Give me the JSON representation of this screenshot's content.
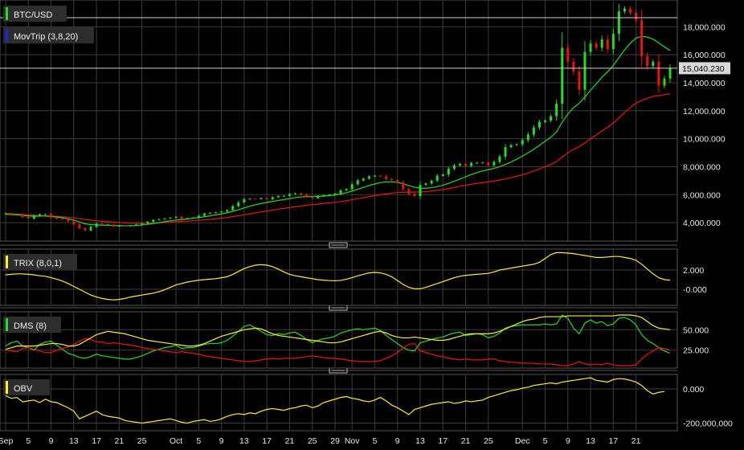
{
  "colors": {
    "background": "#000000",
    "grid": "#3c3c3c",
    "axis_text": "#e6e6e6",
    "candle_up": "#22dd22",
    "candle_down": "#ee1111",
    "ma_fast": "#22dd22",
    "ma_slow": "#ee1111",
    "indicator_yellow": "#ffee22",
    "label_bg": "#2d2d2d",
    "price_tag_bg": "#d8d8d8"
  },
  "chart_data": [
    {
      "type": "candlestick",
      "title": "BTC/USD",
      "legend_color": "#22dd22",
      "overlay": {
        "label": "MovTrip (3,8,20)",
        "legend_color": "#1a2ad8"
      },
      "last_price_label": "15,040.230",
      "last_price": 15040.23,
      "ylim": [
        2800,
        19800
      ],
      "yticks": [
        4000,
        6000,
        8000,
        10000,
        12000,
        14000,
        16000,
        18000
      ],
      "ytick_labels": [
        "4,000.000",
        "6,000.000",
        "8,000.000",
        "10,000.000",
        "12,000.000",
        "14,000.000",
        "16,000.000",
        "18,000.000"
      ],
      "x_labels": [
        "Sep",
        "5",
        "9",
        "13",
        "17",
        "21",
        "25",
        "Oct",
        "5",
        "9",
        "13",
        "17",
        "21",
        "25",
        "29",
        "Nov",
        "5",
        "9",
        "13",
        "17",
        "21",
        "25",
        "Dec",
        "5",
        "9",
        "13",
        "17",
        "21"
      ],
      "x_label_index": [
        0,
        4,
        8,
        12,
        16,
        20,
        24,
        30,
        34,
        38,
        42,
        46,
        50,
        54,
        58,
        61,
        65,
        69,
        73,
        77,
        81,
        85,
        91,
        95,
        99,
        103,
        107,
        111
      ],
      "close": [
        4680,
        4580,
        4600,
        4400,
        4300,
        4500,
        4600,
        4610,
        4380,
        4280,
        4230,
        4100,
        3880,
        3600,
        3450,
        3700,
        3930,
        3850,
        3870,
        3740,
        3780,
        3750,
        3800,
        3870,
        3950,
        4070,
        4200,
        4250,
        4300,
        4350,
        4420,
        4250,
        4320,
        4360,
        4500,
        4650,
        4710,
        4750,
        4800,
        4900,
        5180,
        5450,
        5680,
        5710,
        5690,
        5760,
        5680,
        5820,
        5900,
        5920,
        6050,
        6100,
        6010,
        5850,
        5750,
        5890,
        5960,
        6000,
        6080,
        6310,
        6400,
        6740,
        7020,
        7150,
        7310,
        7350,
        7320,
        7120,
        7050,
        6880,
        6400,
        6050,
        5900,
        6700,
        6800,
        7000,
        7350,
        7450,
        7850,
        8100,
        8200,
        8050,
        8260,
        8290,
        8300,
        8100,
        8350,
        8730,
        9400,
        9550,
        9600,
        9900,
        10300,
        10800,
        11200,
        11300,
        11600,
        12500,
        16500,
        15500,
        14800,
        13500,
        16200,
        16800,
        16500,
        17100,
        16400,
        17500,
        19100,
        19300,
        19000,
        18500,
        15900,
        15200,
        15500,
        13800,
        14300,
        15040
      ],
      "ma_fast": [
        4590,
        4580,
        4560,
        4520,
        4480,
        4460,
        4470,
        4470,
        4440,
        4400,
        4350,
        4280,
        4180,
        4050,
        3920,
        3860,
        3850,
        3820,
        3820,
        3800,
        3790,
        3780,
        3780,
        3800,
        3830,
        3880,
        3940,
        4000,
        4070,
        4130,
        4190,
        4230,
        4270,
        4310,
        4360,
        4420,
        4490,
        4560,
        4630,
        4710,
        4810,
        4930,
        5060,
        5180,
        5280,
        5370,
        5450,
        5520,
        5590,
        5650,
        5720,
        5790,
        5840,
        5860,
        5870,
        5880,
        5900,
        5930,
        5980,
        6050,
        6140,
        6250,
        6380,
        6520,
        6650,
        6770,
        6860,
        6920,
        6920,
        6880,
        6780,
        6650,
        6530,
        6470,
        6460,
        6500,
        6580,
        6680,
        6810,
        6960,
        7120,
        7280,
        7440,
        7580,
        7700,
        7790,
        7880,
        8000,
        8160,
        8340,
        8540,
        8760,
        8990,
        9250,
        9530,
        9820,
        10110,
        10480,
        11180,
        11760,
        12220,
        12540,
        12980,
        13470,
        13920,
        14390,
        14780,
        15240,
        15800,
        16360,
        16830,
        17190,
        17320,
        17260,
        17120,
        16850,
        16560,
        16300
      ],
      "ma_slow": [
        4650,
        4630,
        4610,
        4590,
        4560,
        4530,
        4510,
        4490,
        4470,
        4450,
        4420,
        4390,
        4340,
        4290,
        4230,
        4180,
        4140,
        4100,
        4070,
        4040,
        4010,
        3990,
        3970,
        3960,
        3950,
        3960,
        3970,
        3990,
        4010,
        4040,
        4070,
        4090,
        4110,
        4140,
        4170,
        4200,
        4240,
        4280,
        4320,
        4370,
        4430,
        4490,
        4560,
        4630,
        4700,
        4770,
        4840,
        4900,
        4960,
        5020,
        5080,
        5140,
        5190,
        5240,
        5280,
        5320,
        5370,
        5410,
        5460,
        5510,
        5570,
        5640,
        5710,
        5780,
        5860,
        5930,
        6000,
        6060,
        6110,
        6150,
        6170,
        6180,
        6180,
        6200,
        6220,
        6260,
        6310,
        6370,
        6440,
        6520,
        6600,
        6670,
        6740,
        6810,
        6870,
        6920,
        6980,
        7050,
        7130,
        7220,
        7320,
        7430,
        7550,
        7690,
        7840,
        8000,
        8160,
        8360,
        8700,
        8990,
        9240,
        9430,
        9700,
        10000,
        10270,
        10560,
        10820,
        11130,
        11500,
        11880,
        12230,
        12540,
        12740,
        12900,
        13030,
        13080,
        13140,
        13230
      ]
    },
    {
      "type": "line",
      "title": "TRIX (8,0,1)",
      "legend_color": "#ffee22",
      "ylim": [
        -1.5,
        4.0
      ],
      "yticks": [
        2,
        0
      ],
      "ytick_labels": [
        "2.000",
        "-0.000"
      ],
      "series": [
        {
          "values": [
            1.5,
            1.55,
            1.6,
            1.6,
            1.55,
            1.5,
            1.4,
            1.35,
            1.2,
            1.05,
            0.85,
            0.6,
            0.3,
            0.0,
            -0.3,
            -0.6,
            -0.8,
            -0.95,
            -1.05,
            -1.1,
            -1.05,
            -0.95,
            -0.8,
            -0.7,
            -0.6,
            -0.5,
            -0.4,
            -0.25,
            -0.05,
            0.2,
            0.45,
            0.6,
            0.75,
            0.85,
            0.95,
            1.0,
            1.05,
            1.1,
            1.2,
            1.3,
            1.55,
            1.85,
            2.15,
            2.35,
            2.5,
            2.55,
            2.5,
            2.35,
            2.1,
            1.8,
            1.55,
            1.4,
            1.3,
            1.2,
            1.1,
            1.0,
            0.95,
            0.9,
            0.88,
            0.92,
            1.05,
            1.2,
            1.4,
            1.55,
            1.7,
            1.75,
            1.7,
            1.55,
            1.3,
            0.9,
            0.5,
            0.2,
            0.05,
            0.05,
            0.2,
            0.4,
            0.6,
            0.8,
            1.0,
            1.2,
            1.35,
            1.45,
            1.5,
            1.55,
            1.6,
            1.65,
            1.8,
            2.0,
            2.1,
            2.2,
            2.3,
            2.4,
            2.5,
            2.6,
            2.8,
            3.2,
            3.6,
            3.8,
            3.8,
            3.75,
            3.7,
            3.6,
            3.5,
            3.4,
            3.3,
            3.3,
            3.35,
            3.4,
            3.4,
            3.3,
            3.2,
            3.0,
            2.6,
            2.1,
            1.6,
            1.2,
            1.0,
            0.95
          ]
        }
      ]
    },
    {
      "type": "line",
      "title": "DMS (8)",
      "legend_color": "#22dd22",
      "ylim": [
        5,
        70
      ],
      "yticks": [
        50,
        25
      ],
      "ytick_labels": [
        "50.000",
        "25.000"
      ],
      "series": [
        {
          "color": "#22dd22",
          "values": [
            30,
            34,
            36,
            30,
            28,
            25,
            32,
            35,
            36,
            31,
            26,
            21,
            19,
            16,
            15,
            17,
            20,
            18,
            17,
            16,
            15,
            14,
            14,
            16,
            18,
            21,
            24,
            26,
            28,
            29,
            31,
            27,
            28,
            28,
            30,
            32,
            33,
            33,
            34,
            37,
            42,
            48,
            54,
            56,
            52,
            48,
            44,
            43,
            45,
            44,
            46,
            47,
            43,
            38,
            34,
            37,
            39,
            40,
            42,
            46,
            48,
            50,
            51,
            50,
            51,
            52,
            49,
            43,
            38,
            33,
            28,
            25,
            24,
            34,
            36,
            38,
            40,
            41,
            44,
            46,
            47,
            43,
            44,
            45,
            44,
            40,
            42,
            46,
            52,
            54,
            55,
            56,
            56,
            56,
            56,
            57,
            56,
            57,
            68,
            64,
            52,
            45,
            58,
            62,
            58,
            60,
            55,
            57,
            64,
            65,
            62,
            56,
            44,
            37,
            33,
            28,
            24,
            21
          ]
        },
        {
          "color": "#ee1111",
          "values": [
            25,
            24,
            23,
            27,
            28,
            26,
            24,
            22,
            22,
            25,
            27,
            29,
            32,
            36,
            39,
            38,
            35,
            35,
            33,
            34,
            33,
            32,
            31,
            30,
            28,
            27,
            26,
            25,
            24,
            23,
            22,
            23,
            22,
            21,
            20,
            18,
            17,
            16,
            15,
            14,
            13,
            12,
            11,
            11,
            12,
            13,
            14,
            15,
            14,
            15,
            15,
            15,
            16,
            17,
            18,
            17,
            16,
            15,
            15,
            14,
            13,
            12,
            11,
            11,
            11,
            11,
            12,
            15,
            18,
            22,
            28,
            32,
            33,
            24,
            22,
            20,
            18,
            17,
            15,
            14,
            13,
            14,
            13,
            13,
            13,
            14,
            14,
            12,
            11,
            10,
            10,
            9,
            9,
            9,
            8,
            8,
            8,
            7,
            6,
            6,
            8,
            11,
            8,
            7,
            8,
            7,
            9,
            7,
            6,
            6,
            6,
            7,
            14,
            20,
            24,
            28,
            27,
            25
          ]
        },
        {
          "color": "#ffee22",
          "values": [
            26,
            28,
            30,
            30,
            30,
            30,
            31,
            32,
            33,
            33,
            32,
            30,
            30,
            32,
            36,
            40,
            44,
            46,
            48,
            47,
            46,
            45,
            43,
            41,
            39,
            37,
            36,
            35,
            34,
            33,
            32,
            31,
            30,
            30,
            31,
            33,
            36,
            39,
            42,
            44,
            46,
            48,
            50,
            51,
            52,
            51,
            48,
            45,
            43,
            42,
            41,
            40,
            39,
            38,
            37,
            36,
            35,
            34,
            34,
            35,
            37,
            39,
            41,
            43,
            45,
            47,
            48,
            46,
            43,
            41,
            40,
            40,
            41,
            40,
            39,
            38,
            37,
            37,
            38,
            40,
            42,
            44,
            45,
            45,
            45,
            45,
            46,
            48,
            51,
            54,
            57,
            60,
            62,
            63,
            65,
            66,
            66,
            66,
            66,
            67,
            67,
            67,
            67,
            67,
            67,
            67,
            67,
            67,
            68,
            68,
            68,
            67,
            65,
            60,
            55,
            52,
            51,
            50
          ]
        }
      ]
    },
    {
      "type": "line",
      "title": "OBV",
      "legend_color": "#ffee22",
      "ylim": [
        -235000000,
        75000000
      ],
      "yticks": [
        0,
        -200000000
      ],
      "ytick_labels": [
        "0.000",
        "-200,000,000"
      ],
      "series": [
        {
          "values": [
            -40000000,
            -55000000,
            -50000000,
            -75000000,
            -70000000,
            -65000000,
            -80000000,
            -60000000,
            -75000000,
            -80000000,
            -95000000,
            -110000000,
            -130000000,
            -175000000,
            -160000000,
            -145000000,
            -130000000,
            -150000000,
            -160000000,
            -165000000,
            -170000000,
            -185000000,
            -190000000,
            -195000000,
            -200000000,
            -195000000,
            -190000000,
            -185000000,
            -180000000,
            -175000000,
            -185000000,
            -195000000,
            -200000000,
            -190000000,
            -185000000,
            -180000000,
            -190000000,
            -185000000,
            -175000000,
            -160000000,
            -150000000,
            -145000000,
            -150000000,
            -140000000,
            -145000000,
            -130000000,
            -120000000,
            -115000000,
            -120000000,
            -125000000,
            -115000000,
            -110000000,
            -100000000,
            -95000000,
            -110000000,
            -100000000,
            -80000000,
            -70000000,
            -60000000,
            -50000000,
            -45000000,
            -55000000,
            -60000000,
            -70000000,
            -75000000,
            -65000000,
            -50000000,
            -70000000,
            -95000000,
            -110000000,
            -130000000,
            -150000000,
            -120000000,
            -110000000,
            -100000000,
            -90000000,
            -85000000,
            -80000000,
            -75000000,
            -85000000,
            -80000000,
            -70000000,
            -75000000,
            -70000000,
            -65000000,
            -50000000,
            -40000000,
            -30000000,
            -20000000,
            -10000000,
            -5000000,
            5000000,
            10000000,
            20000000,
            25000000,
            30000000,
            35000000,
            30000000,
            40000000,
            45000000,
            50000000,
            55000000,
            60000000,
            65000000,
            50000000,
            45000000,
            40000000,
            55000000,
            60000000,
            58000000,
            50000000,
            40000000,
            20000000,
            -10000000,
            -30000000,
            -20000000,
            -15000000
          ]
        }
      ]
    }
  ]
}
